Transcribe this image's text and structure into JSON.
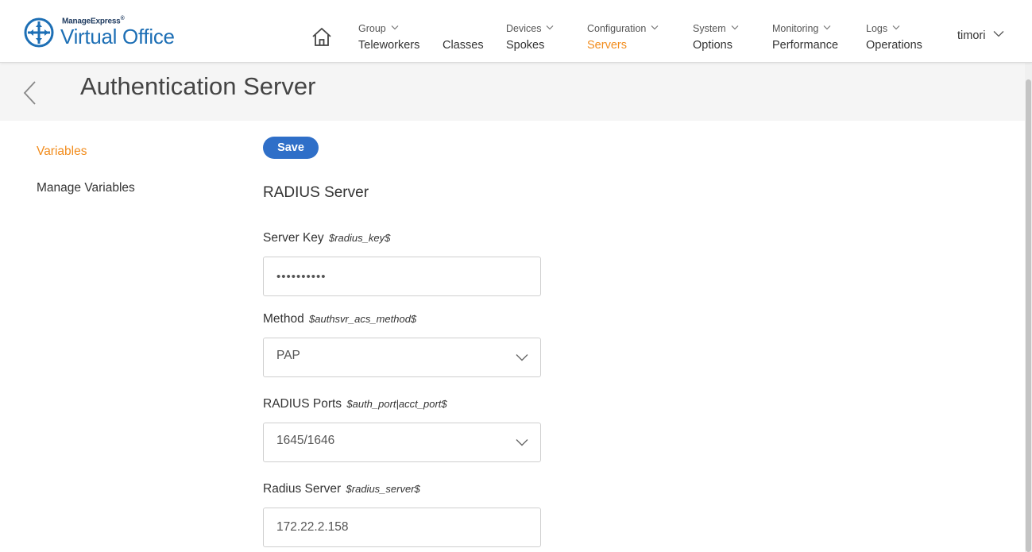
{
  "app": {
    "brand": "ManageExpress",
    "brand_mark": "®",
    "name": "Virtual Office"
  },
  "nav": {
    "items": [
      {
        "group": "Group",
        "label": "Teleworkers"
      },
      {
        "group": "",
        "label": "Classes"
      },
      {
        "group": "Devices",
        "label": "Spokes"
      },
      {
        "group": "Configuration",
        "label": "Servers"
      },
      {
        "group": "System",
        "label": "Options"
      },
      {
        "group": "Monitoring",
        "label": "Performance"
      },
      {
        "group": "Logs",
        "label": "Operations"
      }
    ],
    "active": "Servers",
    "user": "timori"
  },
  "page": {
    "title": "Authentication Server"
  },
  "sidebar": {
    "items": [
      {
        "label": "Variables",
        "active": true
      },
      {
        "label": "Manage Variables",
        "active": false
      }
    ]
  },
  "form": {
    "save_label": "Save",
    "section_title": "RADIUS Server",
    "fields": [
      {
        "label": "Server Key",
        "variable": "$radius_key$",
        "type": "password",
        "value": "••••••••••"
      },
      {
        "label": "Method",
        "variable": "$authsvr_acs_method$",
        "type": "select",
        "value": "PAP"
      },
      {
        "label": "RADIUS Ports",
        "variable": "$auth_port|acct_port$",
        "type": "select",
        "value": "1645/1646"
      },
      {
        "label": "Radius Server",
        "variable": "$radius_server$",
        "type": "text",
        "value": "172.22.2.158"
      }
    ]
  },
  "colors": {
    "accent": "#f28c1c",
    "primary_button": "#2f6fc8",
    "logo": "#1d6fb5"
  },
  "icons": {
    "logo": "compass-cross-icon",
    "home": "home-icon",
    "back": "chevron-left-icon",
    "dropdown": "chevron-down-icon"
  }
}
